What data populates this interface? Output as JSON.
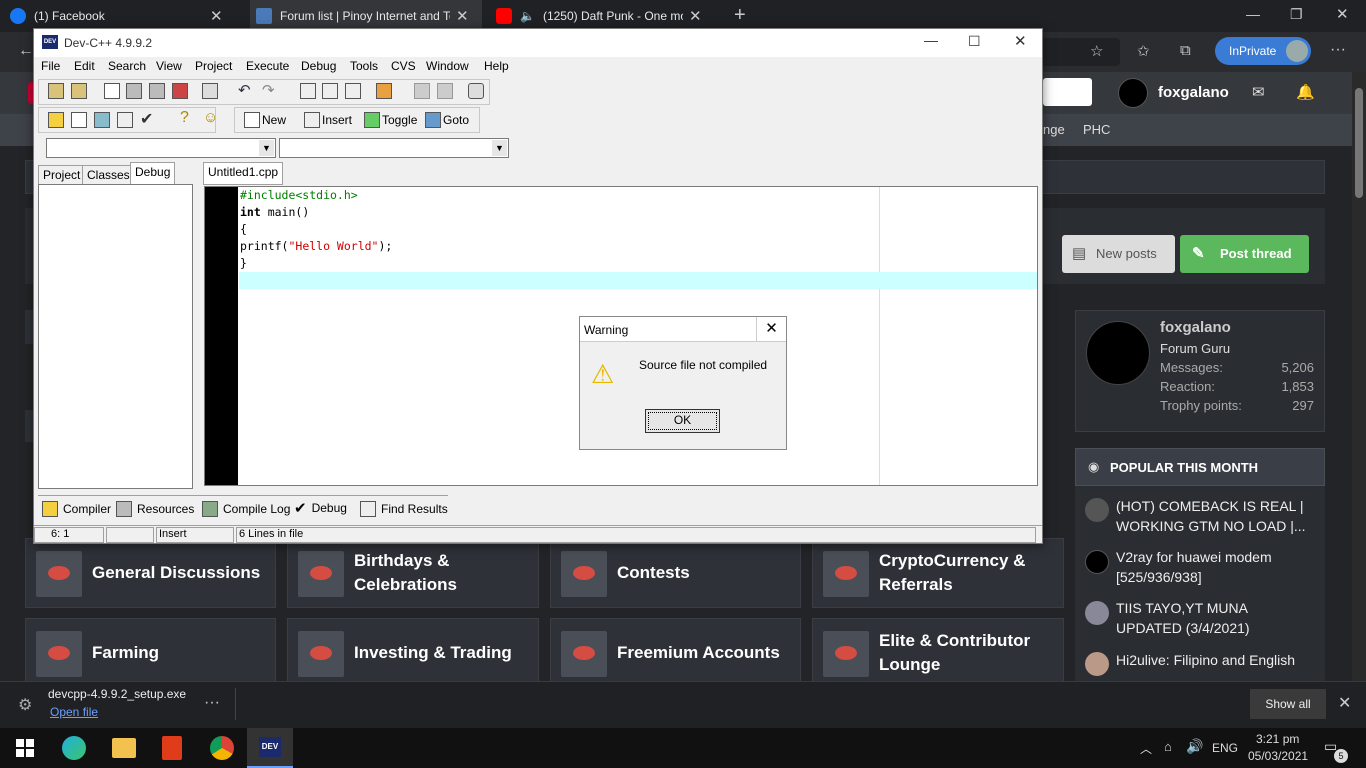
{
  "browser": {
    "tabs": [
      {
        "title": "(1) Facebook",
        "color": "#1877f2"
      },
      {
        "title": "Forum list | Pinoy Internet and Te",
        "color": "#4a7ab8"
      },
      {
        "title": "(1250) Daft Punk - One mor",
        "color": "#ff0000"
      }
    ],
    "inprivate_label": "InPrivate"
  },
  "site": {
    "username": "foxgalano",
    "nav_items": [
      "nge",
      "PHC"
    ],
    "new_posts": "New posts",
    "post_thread": "Post thread"
  },
  "devcpp": {
    "title": "Dev-C++ 4.9.9.2",
    "menu": [
      "File",
      "Edit",
      "Search",
      "View",
      "Project",
      "Execute",
      "Debug",
      "Tools",
      "CVS",
      "Window",
      "Help"
    ],
    "toolbar_labels": {
      "new": "New",
      "insert": "Insert",
      "toggle": "Toggle",
      "goto": "Goto"
    },
    "left_tabs": [
      "Project",
      "Classes",
      "Debug"
    ],
    "file_tab": "Untitled1.cpp",
    "code": {
      "l1": "#include<stdio.h>",
      "l2_kw": "int",
      "l2_rest": " main()",
      "l3": "{",
      "l4_a": "printf(",
      "l4_str": "\"Hello World\"",
      "l4_b": ");",
      "l5": "}"
    },
    "bottom_tabs": [
      "Compiler",
      "Resources",
      "Compile Log",
      "Debug",
      "Find Results"
    ],
    "status": {
      "pos": "6: 1",
      "mode": "Insert",
      "lines": "6 Lines in file"
    }
  },
  "dialog": {
    "title": "Warning",
    "message": "Source file not compiled",
    "ok": "OK"
  },
  "profile": {
    "name": "foxgalano",
    "role": "Forum Guru",
    "stats": [
      {
        "label": "Messages:",
        "value": "5,206"
      },
      {
        "label": "Reaction:",
        "value": "1,853"
      },
      {
        "label": "Trophy points:",
        "value": "297"
      }
    ]
  },
  "popular": {
    "heading": "POPULAR THIS MONTH",
    "items": [
      "(HOT) COMEBACK IS REAL | WORKING GTM NO LOAD |...",
      "V2ray for huawei modem [525/936/938]",
      "TIIS TAYO,YT MUNA UPDATED (3/4/2021)",
      "Hi2ulive: Filipino and English"
    ]
  },
  "forums": {
    "row1": [
      "General Discussions",
      "Birthdays & Celebrations",
      "Contests",
      "CryptoCurrency & Referrals"
    ],
    "row2": [
      "Farming",
      "Investing & Trading",
      "Freemium Accounts",
      "Elite & Contributor Lounge"
    ]
  },
  "download": {
    "file": "devcpp-4.9.9.2_setup.exe",
    "open": "Open file",
    "show_all": "Show all"
  },
  "taskbar": {
    "lang": "ENG",
    "time": "3:21 pm",
    "date": "05/03/2021",
    "notif": "5",
    "dev_label": "DEV"
  },
  "colors": {
    "accent_green": "#5cb85c",
    "inprivate": "#3a7bd5",
    "selection_line": "#ccffff"
  }
}
